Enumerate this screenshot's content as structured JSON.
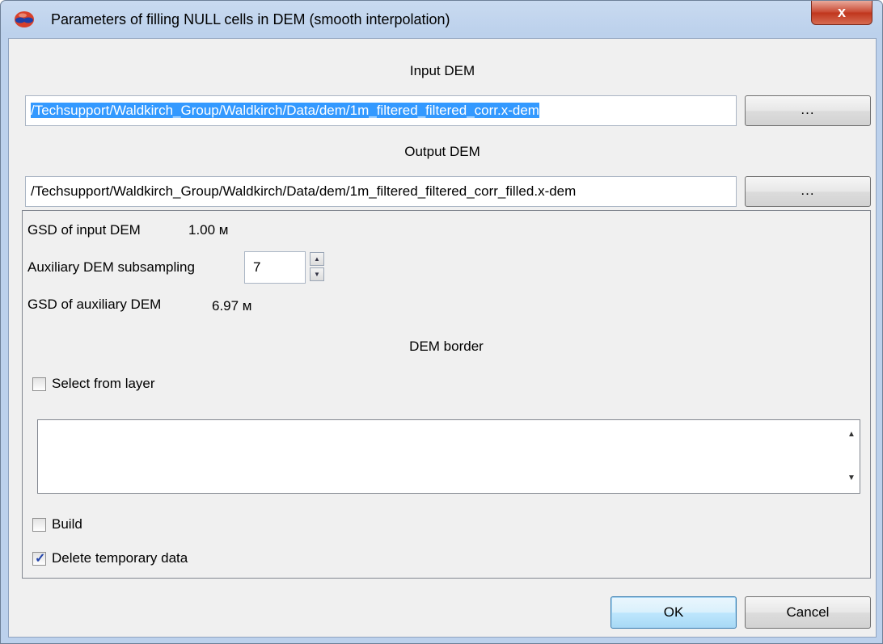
{
  "window": {
    "title": "Parameters of filling NULL cells in DEM (smooth interpolation)",
    "close_glyph": "x"
  },
  "input_dem": {
    "label": "Input DEM",
    "path": "/Techsupport/Waldkirch_Group/Waldkirch/Data/dem/1m_filtered_filtered_corr.x-dem",
    "browse_label": "..."
  },
  "output_dem": {
    "label": "Output DEM",
    "path": "/Techsupport/Waldkirch_Group/Waldkirch/Data/dem/1m_filtered_filtered_corr_filled.x-dem",
    "browse_label": "..."
  },
  "params": {
    "gsd_input_label": "GSD of input DEM",
    "gsd_input_value": "1.00 м",
    "subsampling_label": "Auxiliary DEM subsampling",
    "subsampling_value": "7",
    "gsd_aux_label": "GSD of auxiliary DEM",
    "gsd_aux_value": "6.97 м"
  },
  "border": {
    "label": "DEM border",
    "select_from_layer_label": "Select from layer",
    "select_from_layer_checked": false,
    "text": ""
  },
  "options": {
    "build_label": "Build",
    "build_checked": false,
    "delete_temp_label": "Delete temporary data",
    "delete_temp_checked": true
  },
  "buttons": {
    "ok_label": "OK",
    "cancel_label": "Cancel"
  }
}
